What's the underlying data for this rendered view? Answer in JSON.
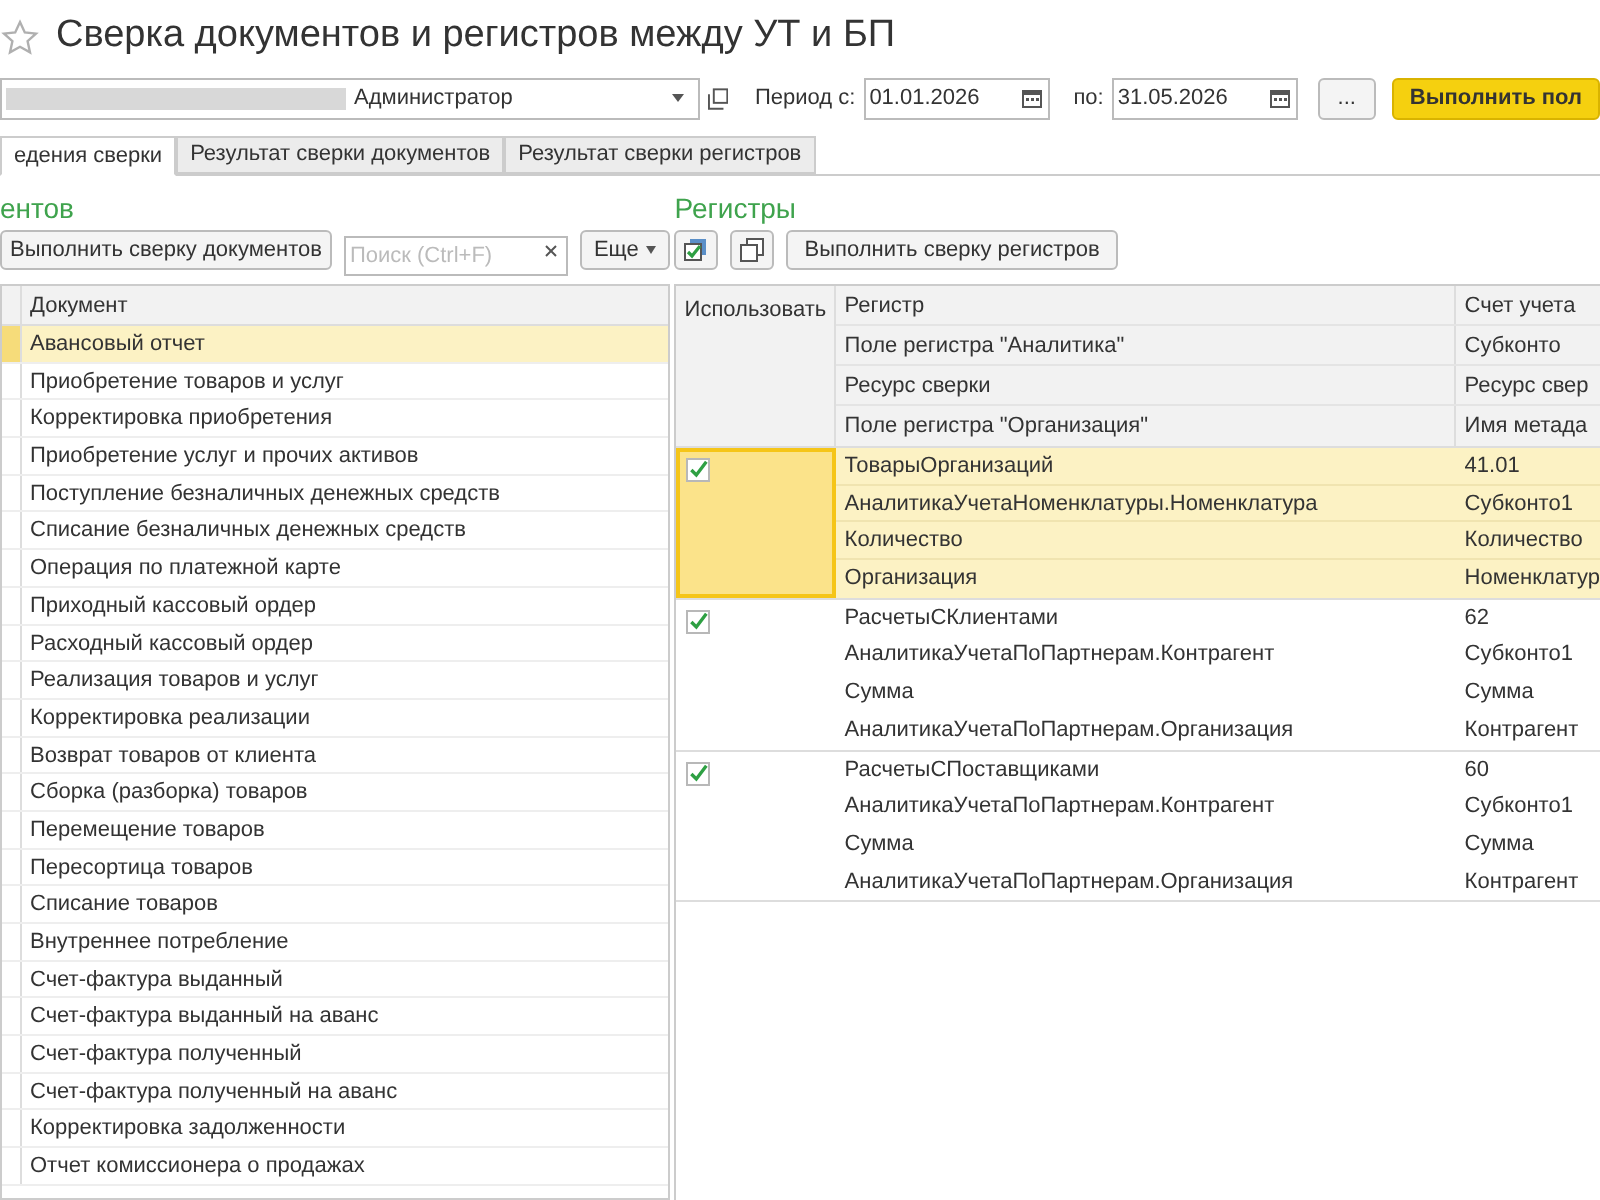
{
  "window": {
    "title": "Сверка документов и регистров между УТ и БП",
    "favorite": false
  },
  "top_bar": {
    "user": "Администратор",
    "period_from_label": "Период с:",
    "period_from": "01.01.2026",
    "period_to_label": "по:",
    "period_to": "31.05.2026",
    "more_button": "...",
    "run_button": "Выполнить пол"
  },
  "tabs": [
    {
      "label": "едения сверки",
      "selected": true
    },
    {
      "label": "Результат сверки документов",
      "selected": false
    },
    {
      "label": "Результат сверки регистров",
      "selected": false
    }
  ],
  "documents": {
    "title": "ентов",
    "run_button": "Выполнить сверку документов",
    "search": {
      "placeholder": "Поиск (Ctrl+F)"
    },
    "more_button": "Еще",
    "column": "Документ",
    "rows": [
      {
        "name": "Авансовый отчет",
        "selected": true
      },
      {
        "name": "Приобретение товаров и услуг",
        "selected": false
      },
      {
        "name": "Корректировка приобретения",
        "selected": false
      },
      {
        "name": "Приобретение услуг и прочих активов",
        "selected": false
      },
      {
        "name": "Поступление безналичных денежных средств",
        "selected": false
      },
      {
        "name": "Списание безналичных денежных средств",
        "selected": false
      },
      {
        "name": "Операция по платежной карте",
        "selected": false
      },
      {
        "name": "Приходный кассовый ордер",
        "selected": false
      },
      {
        "name": "Расходный кассовый ордер",
        "selected": false
      },
      {
        "name": "Реализация товаров и услуг",
        "selected": false
      },
      {
        "name": "Корректировка реализации",
        "selected": false
      },
      {
        "name": "Возврат товаров от клиента",
        "selected": false
      },
      {
        "name": "Сборка (разборка) товаров",
        "selected": false
      },
      {
        "name": "Перемещение товаров",
        "selected": false
      },
      {
        "name": "Пересортица товаров",
        "selected": false
      },
      {
        "name": "Списание товаров",
        "selected": false
      },
      {
        "name": "Внутреннее потребление",
        "selected": false
      },
      {
        "name": "Счет-фактура выданный",
        "selected": false
      },
      {
        "name": "Счет-фактура выданный на аванс",
        "selected": false
      },
      {
        "name": "Счет-фактура полученный",
        "selected": false
      },
      {
        "name": "Счет-фактура полученный на аванс",
        "selected": false
      },
      {
        "name": "Корректировка задолженности",
        "selected": false
      },
      {
        "name": "Отчет комиссионера о продажах",
        "selected": false
      }
    ]
  },
  "registers": {
    "title": "Регистры",
    "run_button": "Выполнить сверку регистров",
    "header": {
      "use": "Использовать",
      "lines": [
        [
          "Регистр",
          "Счет учета"
        ],
        [
          "Поле регистра \"Аналитика\"",
          "Субконто"
        ],
        [
          "Ресурс сверки",
          "Ресурс свер"
        ],
        [
          "Поле регистра \"Организация\"",
          "Имя метада"
        ]
      ]
    },
    "rows": [
      {
        "checked": true,
        "selected": true,
        "lines": [
          [
            "ТоварыОрганизаций",
            "41.01"
          ],
          [
            "АналитикаУчетаНоменклатуры.Номенклатура",
            "Субконто1"
          ],
          [
            "Количество",
            "Количество"
          ],
          [
            "Организация",
            "Номенклатур"
          ]
        ]
      },
      {
        "checked": true,
        "selected": false,
        "lines": [
          [
            "РасчетыСКлиентами",
            "62"
          ],
          [
            "АналитикаУчетаПоПартнерам.Контрагент",
            "Субконто1"
          ],
          [
            "Сумма",
            "Сумма"
          ],
          [
            "АналитикаУчетаПоПартнерам.Организация",
            "Контрагент"
          ]
        ]
      },
      {
        "checked": true,
        "selected": false,
        "lines": [
          [
            "РасчетыСПоставщиками",
            "60"
          ],
          [
            "АналитикаУчетаПоПартнерам.Контрагент",
            "Субконто1"
          ],
          [
            "Сумма",
            "Сумма"
          ],
          [
            "АналитикаУчетаПоПартнерам.Организация",
            "Контрагент"
          ]
        ]
      }
    ]
  }
}
